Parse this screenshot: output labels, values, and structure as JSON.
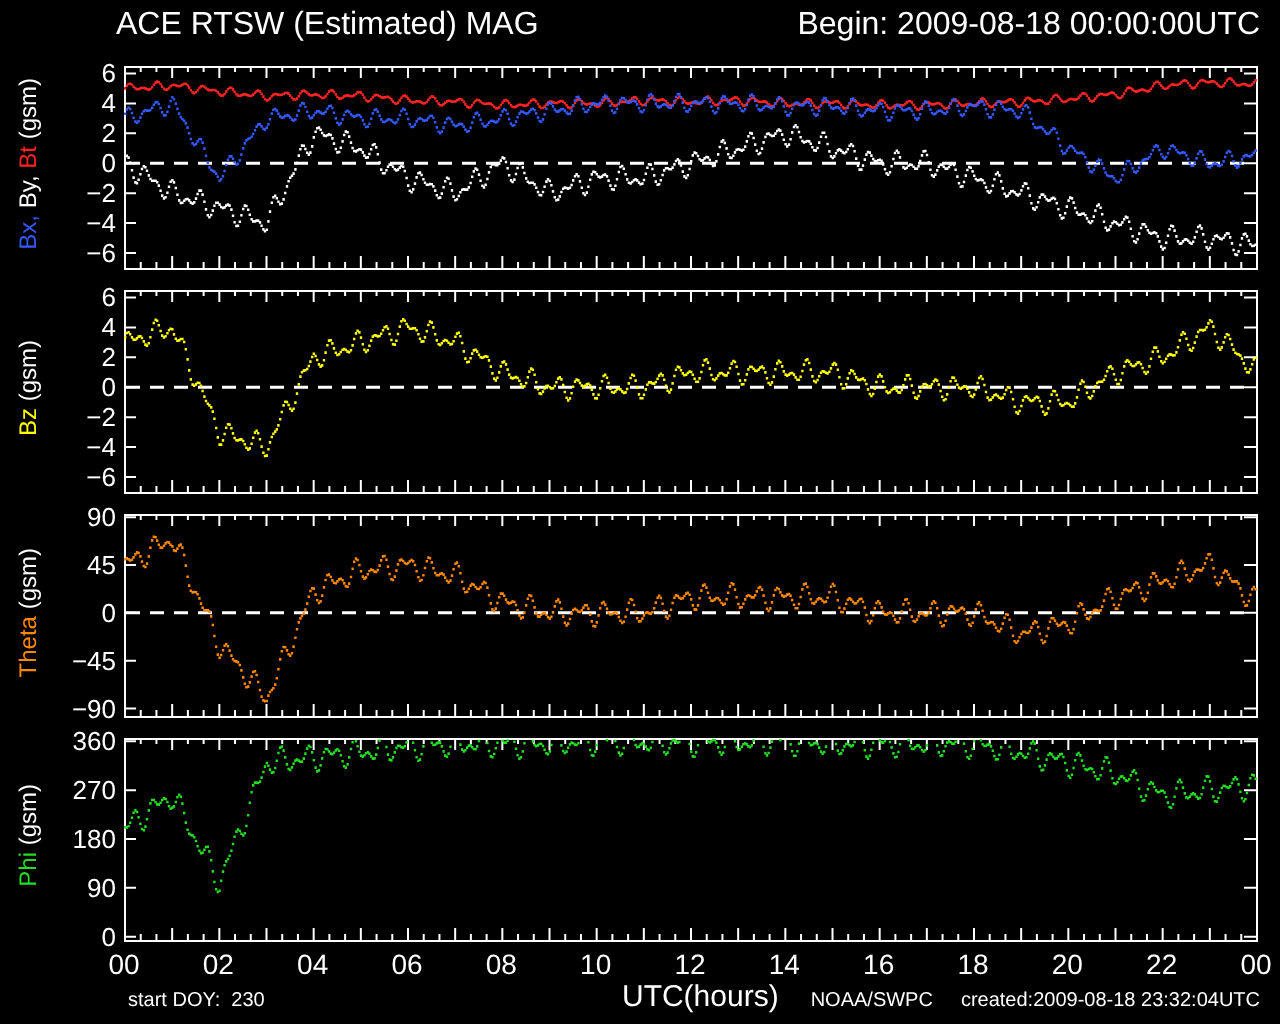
{
  "header": {
    "title": "ACE RTSW (Estimated) MAG",
    "begin": "Begin: 2009-08-18 00:00:00UTC"
  },
  "panels": [
    {
      "axis_label": [
        {
          "text": "Bx,",
          "color": "#3358ff"
        },
        {
          "text": "By,",
          "color": "#ffffff"
        },
        {
          "text": "Bt",
          "color": "#ff2222"
        },
        {
          "text": "(gsm)",
          "color": "#ffffff"
        }
      ],
      "zero_line": true,
      "y_ticks": [
        "6",
        "4",
        "2",
        "0",
        "−2",
        "−4",
        "−6"
      ],
      "traces": [
        {
          "color": "#ff2222"
        },
        {
          "color": "#3358ff"
        },
        {
          "color": "#ffffff"
        }
      ]
    },
    {
      "axis_label": [
        {
          "text": "Bz",
          "color": "#ffff00"
        },
        {
          "text": "(gsm)",
          "color": "#ffffff"
        }
      ],
      "zero_line": true,
      "y_ticks": [
        "6",
        "4",
        "2",
        "0",
        "−2",
        "−4",
        "−6"
      ],
      "traces": [
        {
          "color": "#ffff00"
        }
      ]
    },
    {
      "axis_label": [
        {
          "text": "Theta",
          "color": "#ff8800"
        },
        {
          "text": "(gsm)",
          "color": "#ffffff"
        }
      ],
      "zero_line": true,
      "y_ticks": [
        "90",
        "45",
        "0",
        "−45",
        "−90"
      ],
      "traces": [
        {
          "color": "#ff8800"
        }
      ]
    },
    {
      "axis_label": [
        {
          "text": "Phi",
          "color": "#22dd22"
        },
        {
          "text": "(gsm)",
          "color": "#ffffff"
        }
      ],
      "zero_line": false,
      "y_ticks": [
        "360",
        "270",
        "180",
        "90",
        "0"
      ],
      "traces": [
        {
          "color": "#22dd22"
        }
      ],
      "x_ticks": [
        "00",
        "02",
        "04",
        "06",
        "08",
        "10",
        "12",
        "14",
        "16",
        "18",
        "20",
        "22",
        "00"
      ]
    }
  ],
  "footer": {
    "start": "start DOY:  230",
    "xlabel": "UTC(hours)",
    "source": "NOAA/SWPC",
    "created": "created:2009-08-18 23:32:04UTC"
  }
}
